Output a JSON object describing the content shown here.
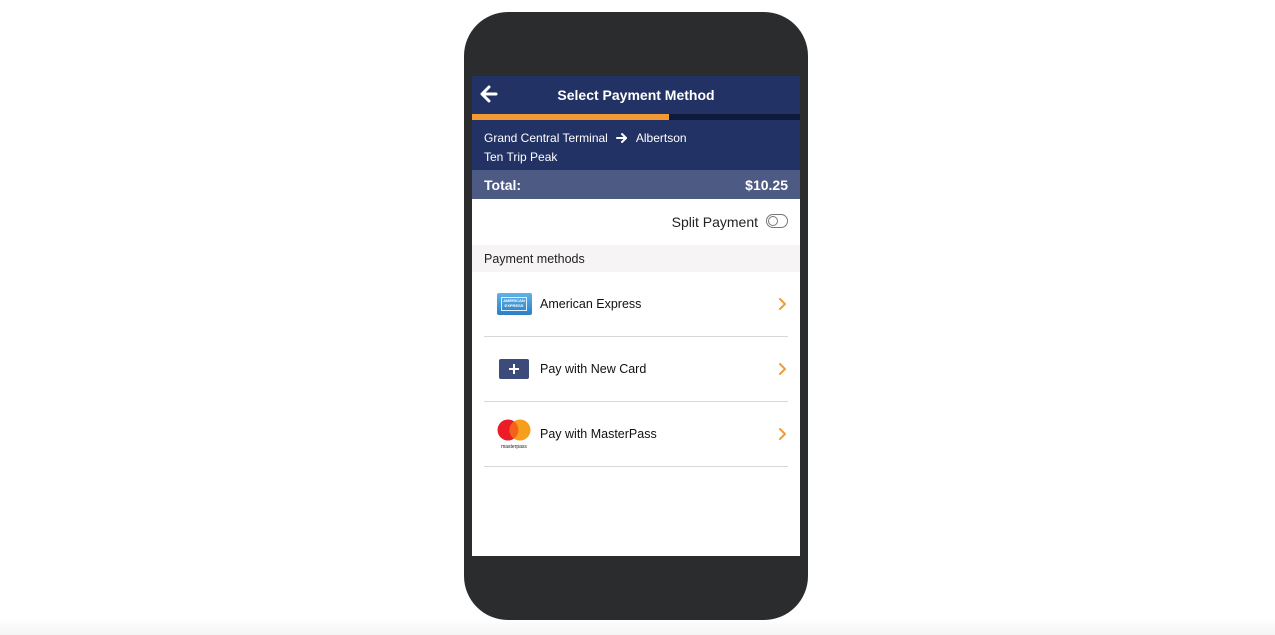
{
  "header": {
    "title": "Select Payment Method",
    "back_icon": "arrow-left-icon"
  },
  "progress": {
    "value": 0.6,
    "color": "#f39a34"
  },
  "trip": {
    "origin": "Grand Central Terminal",
    "destination": "Albertson",
    "route_icon": "arrow-right-icon",
    "fare_type": "Ten Trip Peak"
  },
  "total": {
    "label": "Total:",
    "amount": "$10.25"
  },
  "split_payment": {
    "label": "Split Payment",
    "enabled": false
  },
  "payment_methods": {
    "section_label": "Payment methods",
    "items": [
      {
        "label": "American Express",
        "icon": "amex-card-icon",
        "logo_text": "AMERICAN EXPRESS"
      },
      {
        "label": "Pay with New Card",
        "icon": "add-card-icon"
      },
      {
        "label": "Pay with MasterPass",
        "icon": "masterpass-icon",
        "logo_text": "masterpass"
      }
    ]
  },
  "colors": {
    "header_bg": "#233264",
    "total_bg": "#4d5a83",
    "accent": "#f39a34",
    "phone_frame": "#2b2c2e"
  }
}
